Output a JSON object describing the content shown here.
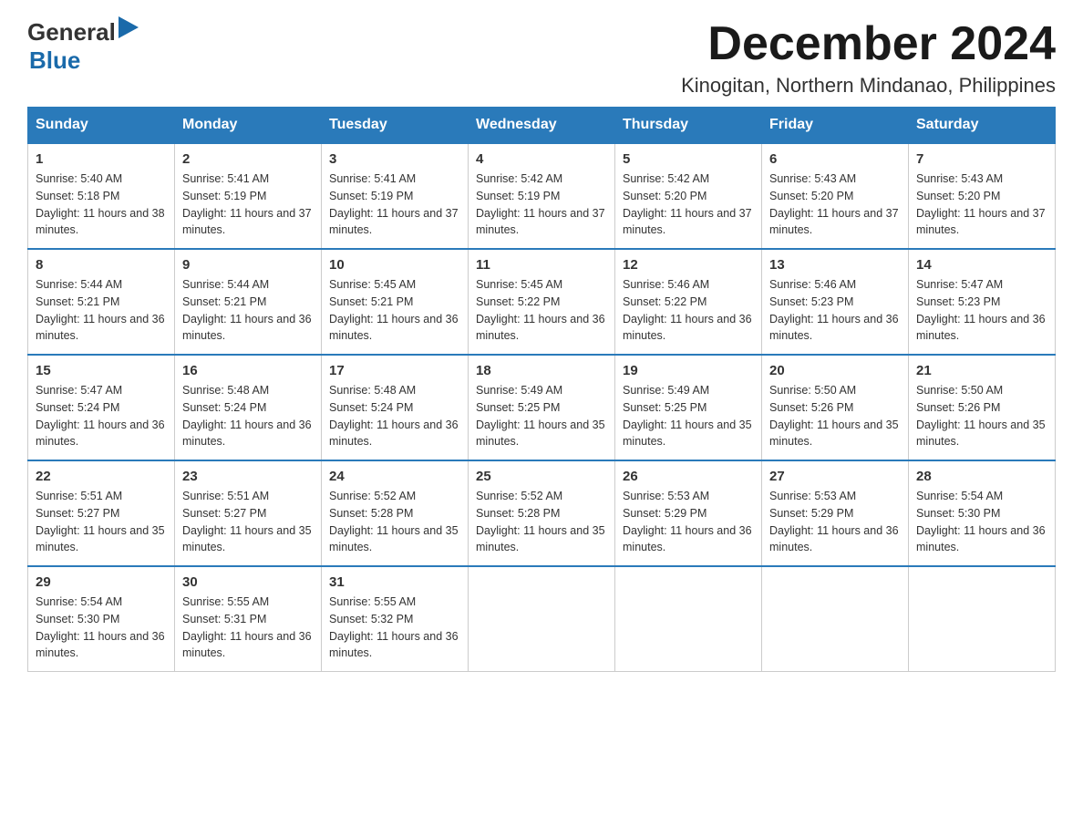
{
  "header": {
    "logo_general": "General",
    "logo_blue": "Blue",
    "title": "December 2024",
    "subtitle": "Kinogitan, Northern Mindanao, Philippines"
  },
  "calendar": {
    "days_of_week": [
      "Sunday",
      "Monday",
      "Tuesday",
      "Wednesday",
      "Thursday",
      "Friday",
      "Saturday"
    ],
    "weeks": [
      [
        {
          "day": "1",
          "sunrise": "Sunrise: 5:40 AM",
          "sunset": "Sunset: 5:18 PM",
          "daylight": "Daylight: 11 hours and 38 minutes."
        },
        {
          "day": "2",
          "sunrise": "Sunrise: 5:41 AM",
          "sunset": "Sunset: 5:19 PM",
          "daylight": "Daylight: 11 hours and 37 minutes."
        },
        {
          "day": "3",
          "sunrise": "Sunrise: 5:41 AM",
          "sunset": "Sunset: 5:19 PM",
          "daylight": "Daylight: 11 hours and 37 minutes."
        },
        {
          "day": "4",
          "sunrise": "Sunrise: 5:42 AM",
          "sunset": "Sunset: 5:19 PM",
          "daylight": "Daylight: 11 hours and 37 minutes."
        },
        {
          "day": "5",
          "sunrise": "Sunrise: 5:42 AM",
          "sunset": "Sunset: 5:20 PM",
          "daylight": "Daylight: 11 hours and 37 minutes."
        },
        {
          "day": "6",
          "sunrise": "Sunrise: 5:43 AM",
          "sunset": "Sunset: 5:20 PM",
          "daylight": "Daylight: 11 hours and 37 minutes."
        },
        {
          "day": "7",
          "sunrise": "Sunrise: 5:43 AM",
          "sunset": "Sunset: 5:20 PM",
          "daylight": "Daylight: 11 hours and 37 minutes."
        }
      ],
      [
        {
          "day": "8",
          "sunrise": "Sunrise: 5:44 AM",
          "sunset": "Sunset: 5:21 PM",
          "daylight": "Daylight: 11 hours and 36 minutes."
        },
        {
          "day": "9",
          "sunrise": "Sunrise: 5:44 AM",
          "sunset": "Sunset: 5:21 PM",
          "daylight": "Daylight: 11 hours and 36 minutes."
        },
        {
          "day": "10",
          "sunrise": "Sunrise: 5:45 AM",
          "sunset": "Sunset: 5:21 PM",
          "daylight": "Daylight: 11 hours and 36 minutes."
        },
        {
          "day": "11",
          "sunrise": "Sunrise: 5:45 AM",
          "sunset": "Sunset: 5:22 PM",
          "daylight": "Daylight: 11 hours and 36 minutes."
        },
        {
          "day": "12",
          "sunrise": "Sunrise: 5:46 AM",
          "sunset": "Sunset: 5:22 PM",
          "daylight": "Daylight: 11 hours and 36 minutes."
        },
        {
          "day": "13",
          "sunrise": "Sunrise: 5:46 AM",
          "sunset": "Sunset: 5:23 PM",
          "daylight": "Daylight: 11 hours and 36 minutes."
        },
        {
          "day": "14",
          "sunrise": "Sunrise: 5:47 AM",
          "sunset": "Sunset: 5:23 PM",
          "daylight": "Daylight: 11 hours and 36 minutes."
        }
      ],
      [
        {
          "day": "15",
          "sunrise": "Sunrise: 5:47 AM",
          "sunset": "Sunset: 5:24 PM",
          "daylight": "Daylight: 11 hours and 36 minutes."
        },
        {
          "day": "16",
          "sunrise": "Sunrise: 5:48 AM",
          "sunset": "Sunset: 5:24 PM",
          "daylight": "Daylight: 11 hours and 36 minutes."
        },
        {
          "day": "17",
          "sunrise": "Sunrise: 5:48 AM",
          "sunset": "Sunset: 5:24 PM",
          "daylight": "Daylight: 11 hours and 36 minutes."
        },
        {
          "day": "18",
          "sunrise": "Sunrise: 5:49 AM",
          "sunset": "Sunset: 5:25 PM",
          "daylight": "Daylight: 11 hours and 35 minutes."
        },
        {
          "day": "19",
          "sunrise": "Sunrise: 5:49 AM",
          "sunset": "Sunset: 5:25 PM",
          "daylight": "Daylight: 11 hours and 35 minutes."
        },
        {
          "day": "20",
          "sunrise": "Sunrise: 5:50 AM",
          "sunset": "Sunset: 5:26 PM",
          "daylight": "Daylight: 11 hours and 35 minutes."
        },
        {
          "day": "21",
          "sunrise": "Sunrise: 5:50 AM",
          "sunset": "Sunset: 5:26 PM",
          "daylight": "Daylight: 11 hours and 35 minutes."
        }
      ],
      [
        {
          "day": "22",
          "sunrise": "Sunrise: 5:51 AM",
          "sunset": "Sunset: 5:27 PM",
          "daylight": "Daylight: 11 hours and 35 minutes."
        },
        {
          "day": "23",
          "sunrise": "Sunrise: 5:51 AM",
          "sunset": "Sunset: 5:27 PM",
          "daylight": "Daylight: 11 hours and 35 minutes."
        },
        {
          "day": "24",
          "sunrise": "Sunrise: 5:52 AM",
          "sunset": "Sunset: 5:28 PM",
          "daylight": "Daylight: 11 hours and 35 minutes."
        },
        {
          "day": "25",
          "sunrise": "Sunrise: 5:52 AM",
          "sunset": "Sunset: 5:28 PM",
          "daylight": "Daylight: 11 hours and 35 minutes."
        },
        {
          "day": "26",
          "sunrise": "Sunrise: 5:53 AM",
          "sunset": "Sunset: 5:29 PM",
          "daylight": "Daylight: 11 hours and 36 minutes."
        },
        {
          "day": "27",
          "sunrise": "Sunrise: 5:53 AM",
          "sunset": "Sunset: 5:29 PM",
          "daylight": "Daylight: 11 hours and 36 minutes."
        },
        {
          "day": "28",
          "sunrise": "Sunrise: 5:54 AM",
          "sunset": "Sunset: 5:30 PM",
          "daylight": "Daylight: 11 hours and 36 minutes."
        }
      ],
      [
        {
          "day": "29",
          "sunrise": "Sunrise: 5:54 AM",
          "sunset": "Sunset: 5:30 PM",
          "daylight": "Daylight: 11 hours and 36 minutes."
        },
        {
          "day": "30",
          "sunrise": "Sunrise: 5:55 AM",
          "sunset": "Sunset: 5:31 PM",
          "daylight": "Daylight: 11 hours and 36 minutes."
        },
        {
          "day": "31",
          "sunrise": "Sunrise: 5:55 AM",
          "sunset": "Sunset: 5:32 PM",
          "daylight": "Daylight: 11 hours and 36 minutes."
        },
        null,
        null,
        null,
        null
      ]
    ]
  }
}
